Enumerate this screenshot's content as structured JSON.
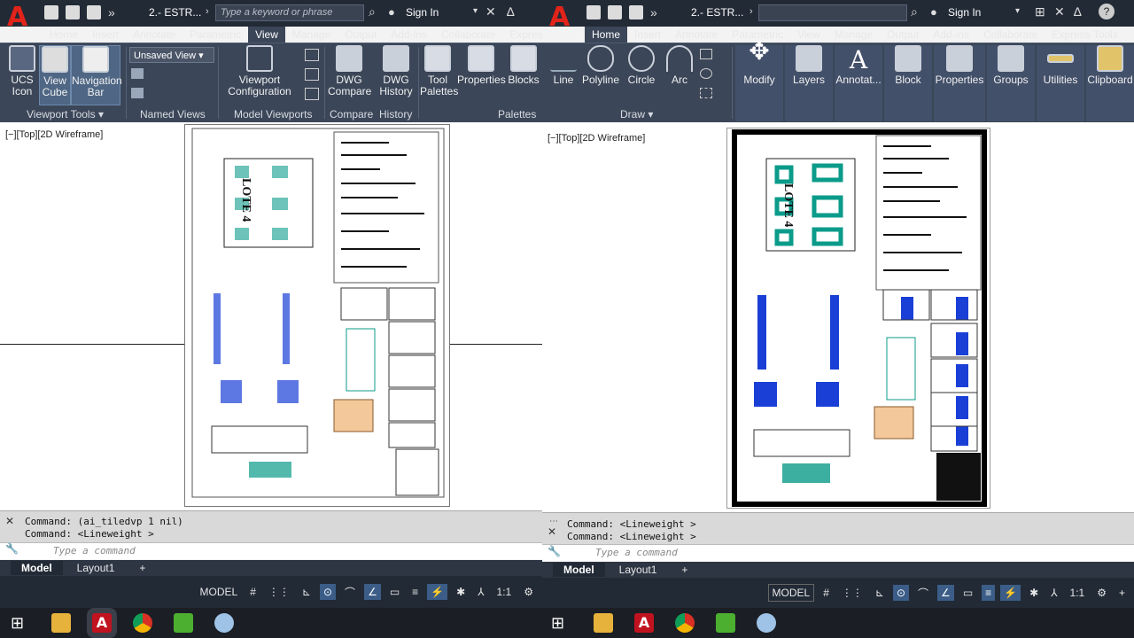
{
  "left": {
    "file_title": "2.- ESTR...",
    "search_placeholder": "Type a keyword or phrase",
    "sign_in": "Sign In",
    "tabs": [
      "Home",
      "Insert",
      "Annotate",
      "Parametric",
      "View",
      "Manage",
      "Output",
      "Add-ins",
      "Collaborate",
      "Expres"
    ],
    "active_tab": "View",
    "ribbon": {
      "ucs_icon": "UCS\nIcon",
      "view_cube": "View\nCube",
      "navigation_bar": "Navigation\nBar",
      "unsaved_view": "Unsaved View",
      "viewport_configuration": "Viewport\nConfiguration",
      "dwg_compare": "DWG\nCompare",
      "dwg_history": "DWG\nHistory",
      "tool_palettes": "Tool\nPalettes",
      "properties": "Properties",
      "blocks": "Blocks"
    },
    "panels": [
      "Viewport Tools",
      "Named Views",
      "Model Viewports",
      "Compare",
      "History",
      "Palettes"
    ],
    "viewport_label": "[−][Top][2D Wireframe]",
    "sheet_label": "LOTE 4",
    "command_history": [
      "Command: (ai_tiledvp 1 nil)",
      "Command:  <Lineweight >"
    ],
    "command_placeholder": "Type a command",
    "layout_tabs": [
      "Model",
      "Layout1",
      "+"
    ],
    "status": [
      "MODEL",
      "#",
      "⋮⋮",
      "⊾",
      "⊙",
      "⌒",
      "∠",
      "▭",
      "≡",
      "⚡",
      "✱",
      "⅄",
      "1:1",
      "⚙"
    ]
  },
  "right": {
    "file_title": "2.- ESTR...",
    "sign_in": "Sign In",
    "tabs": [
      "Home",
      "Insert",
      "Annotate",
      "Parametric",
      "View",
      "Manage",
      "Output",
      "Add-ins",
      "Collaborate",
      "Express Tools"
    ],
    "active_tab": "Home",
    "ribbon": {
      "line": "Line",
      "polyline": "Polyline",
      "circle": "Circle",
      "arc": "Arc",
      "modify": "Modify",
      "layers": "Layers",
      "annotation": "Annotat...",
      "block": "Block",
      "properties": "Properties",
      "groups": "Groups",
      "utilities": "Utilities",
      "clipboard": "Clipboard"
    },
    "draw_panel": "Draw",
    "viewport_label": "[−][Top][2D Wireframe]",
    "sheet_label": "LOTE 4",
    "command_history": [
      "Command:  <Lineweight >",
      "Command:  <Lineweight >"
    ],
    "command_placeholder": "Type a command",
    "layout_tabs": [
      "Model",
      "Layout1",
      "+"
    ],
    "status": [
      "MODEL",
      "#",
      "⋮⋮",
      "⊾",
      "⊙",
      "⌒",
      "∠",
      "▭",
      "≡",
      "⚡",
      "✱",
      "⅄",
      "1:1",
      "⚙",
      "+"
    ]
  },
  "colors": {
    "accent": "#3b5d87",
    "autocad_red": "#e2231a",
    "hatch_teal": "#0b9b8a",
    "blue_detail": "#1a3fd6"
  }
}
